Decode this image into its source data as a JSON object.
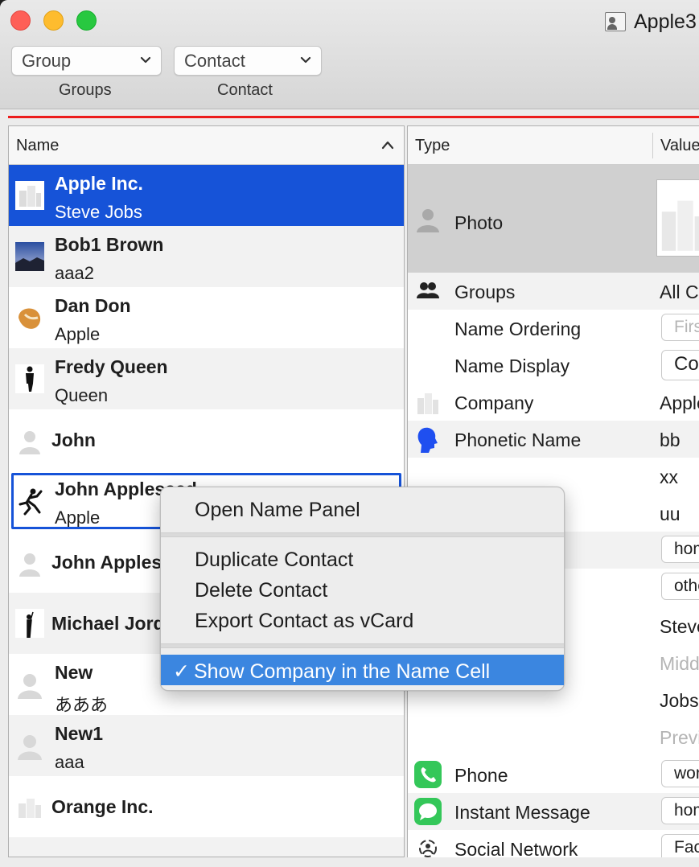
{
  "window": {
    "title": "Apple3",
    "accent": "#1653d8",
    "toolbar": {
      "group_popup": "Group",
      "contact_popup": "Contact",
      "groups_label": "Groups",
      "contact_label": "Contact"
    }
  },
  "list": {
    "header": "Name",
    "rows": [
      {
        "title": "Apple Inc.",
        "sub": "Steve Jobs",
        "icon": "company-icon",
        "state": "selected"
      },
      {
        "title": "Bob1 Brown",
        "sub": "aaa2",
        "icon": "landscape-photo-icon"
      },
      {
        "title": "Dan Don",
        "sub": "Apple",
        "icon": "fortune-cookie-icon"
      },
      {
        "title": "Fredy Queen",
        "sub": "Queen",
        "icon": "silhouette-icon"
      },
      {
        "title": "John",
        "sub": "",
        "icon": "person-placeholder-icon"
      },
      {
        "title": "John Appleseed",
        "sub": "Apple",
        "icon": "running-figure-icon",
        "state": "focused"
      },
      {
        "title": "John Appleseed",
        "sub": "",
        "icon": "person-placeholder-icon"
      },
      {
        "title": "Michael Jordan",
        "sub": "",
        "icon": "silhouette-icon"
      },
      {
        "title": "New",
        "sub": "あああ",
        "icon": "person-placeholder-icon"
      },
      {
        "title": "New1",
        "sub": "aaa",
        "icon": "person-placeholder-icon"
      },
      {
        "title": "Orange Inc.",
        "sub": "",
        "icon": "company-icon"
      }
    ]
  },
  "detail": {
    "type_header": "Type",
    "value_header": "Value",
    "photo_label": "Photo",
    "rows": {
      "groups": {
        "label": "Groups",
        "value": "All Contacts"
      },
      "name_ordering": {
        "label": "Name Ordering",
        "value": "First"
      },
      "name_display": {
        "label": "Name Display",
        "value": "Company"
      },
      "company": {
        "label": "Company",
        "value": "Apple"
      },
      "phonetic_name": {
        "label": "Phonetic Name",
        "value": "bb"
      },
      "phonetic_2": {
        "value": "xx"
      },
      "phonetic_3": {
        "value": "uu"
      },
      "box_home": {
        "value": "home"
      },
      "box_other": {
        "value": "other"
      },
      "first_name": {
        "value": "Steve"
      },
      "middle_name": {
        "value": "Middle"
      },
      "last_name": {
        "value": "Jobs"
      },
      "previous": {
        "value": "Previous"
      },
      "phone": {
        "label": "Phone",
        "value": "work"
      },
      "instant_message": {
        "label": "Instant Message",
        "value": "home"
      },
      "social_network": {
        "label": "Social Network",
        "value": "Facebook"
      }
    }
  },
  "context_menu": {
    "open_name_panel": "Open Name Panel",
    "duplicate": "Duplicate Contact",
    "delete": "Delete Contact",
    "export": "Export Contact as vCard",
    "show_company": "Show Company in the Name Cell",
    "checkmark": "✓"
  }
}
